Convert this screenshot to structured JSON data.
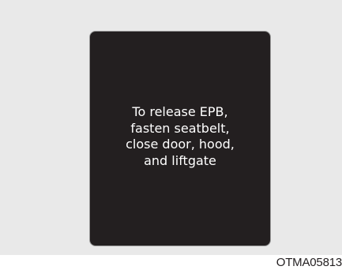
{
  "display": {
    "message_lines": [
      "To release EPB,",
      "fasten seatbelt,",
      "close door, hood,",
      "and liftgate"
    ]
  },
  "figure_code": "OTMA05813",
  "colors": {
    "panel_background": "#e9e9e9",
    "screen_background": "#231f20",
    "screen_text": "#ffffff",
    "code_text": "#231f20"
  }
}
